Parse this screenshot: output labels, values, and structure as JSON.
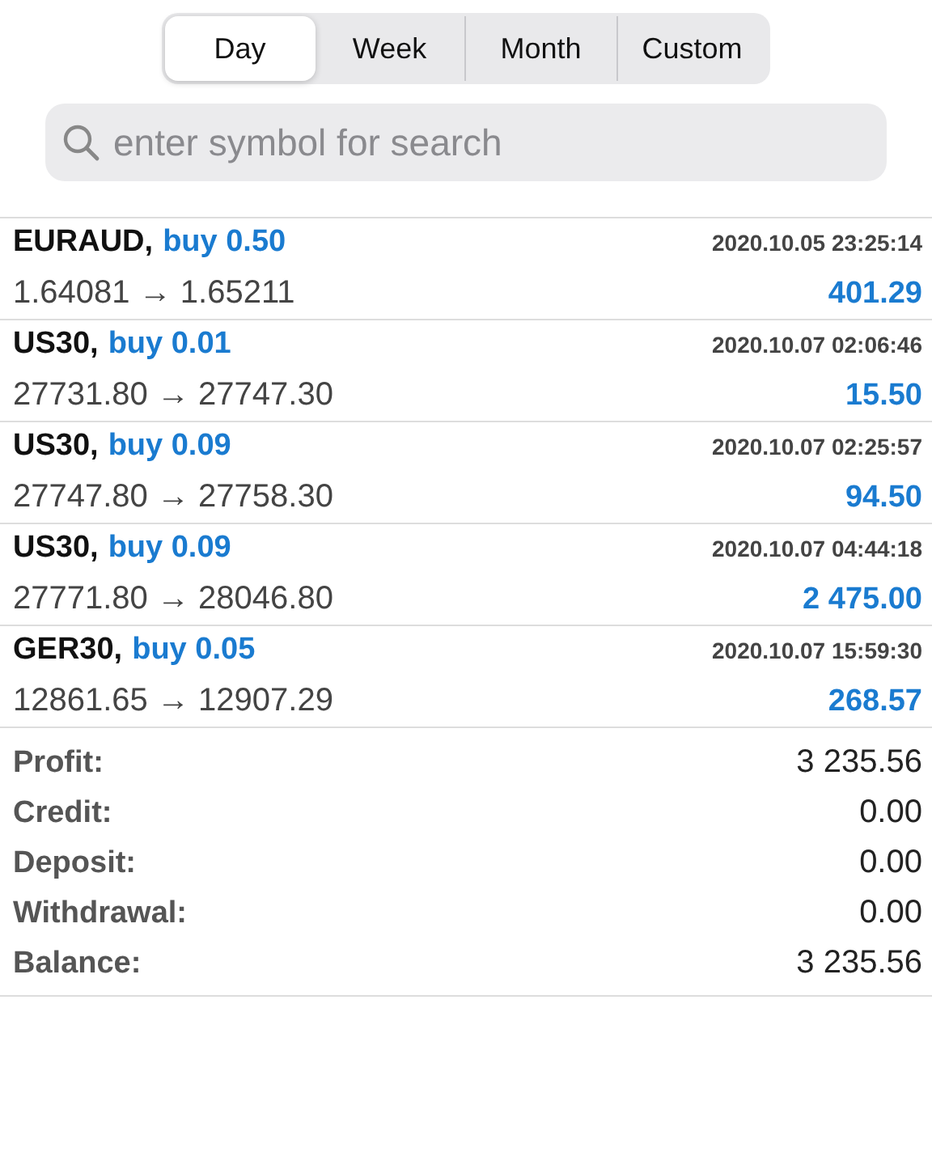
{
  "periods": [
    {
      "label": "Day",
      "selected": true
    },
    {
      "label": "Week",
      "selected": false
    },
    {
      "label": "Month",
      "selected": false
    },
    {
      "label": "Custom",
      "selected": false
    }
  ],
  "search": {
    "placeholder": "enter symbol for search"
  },
  "trades": [
    {
      "symbol": "EURAUD,",
      "action": "buy 0.50",
      "time": "2020.10.05 23:25:14",
      "prices": "1.64081 → 1.65211",
      "profit": "401.29"
    },
    {
      "symbol": "US30,",
      "action": "buy 0.01",
      "time": "2020.10.07 02:06:46",
      "prices": "27731.80 → 27747.30",
      "profit": "15.50"
    },
    {
      "symbol": "US30,",
      "action": "buy 0.09",
      "time": "2020.10.07 02:25:57",
      "prices": "27747.80 → 27758.30",
      "profit": "94.50"
    },
    {
      "symbol": "US30,",
      "action": "buy 0.09",
      "time": "2020.10.07 04:44:18",
      "prices": "27771.80 → 28046.80",
      "profit": "2 475.00"
    },
    {
      "symbol": "GER30,",
      "action": "buy 0.05",
      "time": "2020.10.07 15:59:30",
      "prices": "12861.65 → 12907.29",
      "profit": "268.57"
    }
  ],
  "summary": [
    {
      "label": "Profit:",
      "value": "3 235.56"
    },
    {
      "label": "Credit:",
      "value": "0.00"
    },
    {
      "label": "Deposit:",
      "value": "0.00"
    },
    {
      "label": "Withdrawal:",
      "value": "0.00"
    },
    {
      "label": "Balance:",
      "value": "3 235.56"
    }
  ]
}
